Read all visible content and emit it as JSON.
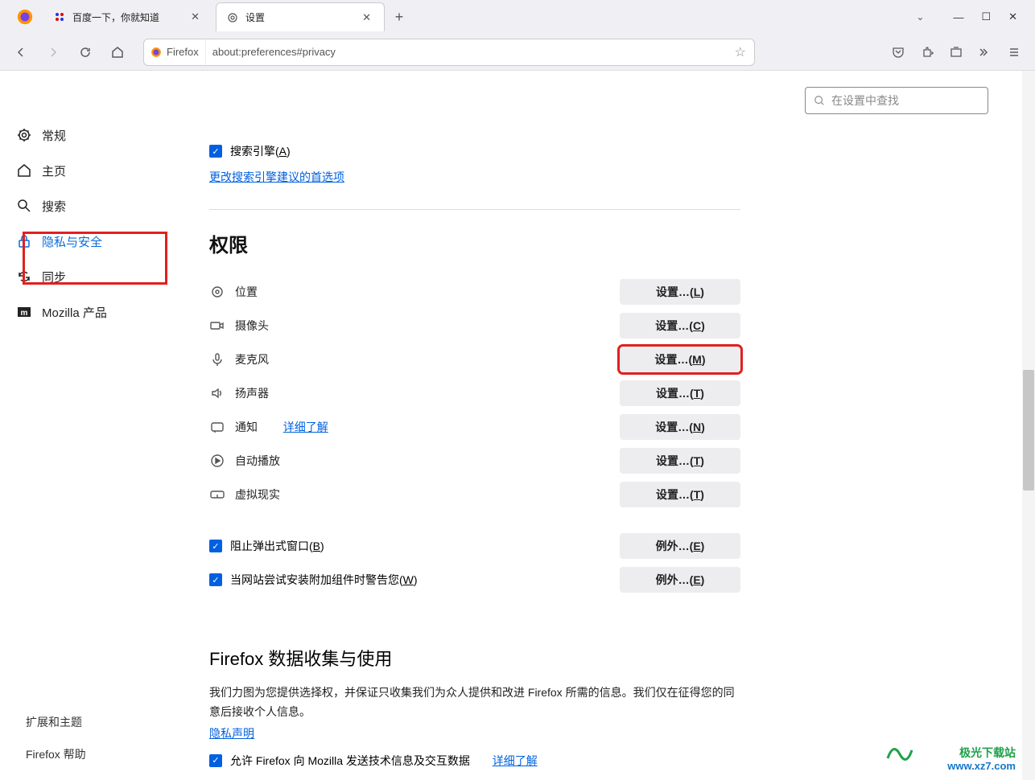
{
  "tabs": {
    "baidu": {
      "title": "百度一下，你就知道"
    },
    "settings": {
      "title": "设置"
    }
  },
  "urlbar": {
    "identity": "Firefox",
    "address": "about:preferences#privacy"
  },
  "search": {
    "placeholder": "在设置中查找"
  },
  "sidebar": {
    "general": "常规",
    "home": "主页",
    "search": "搜索",
    "privacy": "隐私与安全",
    "sync": "同步",
    "mozilla": "Mozilla 产品",
    "extensions": "扩展和主题",
    "help": "Firefox 帮助"
  },
  "checkboxes": {
    "search_engine": "搜索引擎(A)",
    "search_link": "更改搜索引擎建议的首选项",
    "block_popup": "阻止弹出式窗口(B)",
    "warn_addon": "当网站尝试安装附加组件时警告您(W)",
    "telemetry": "允许 Firefox 向 Mozilla 发送技术信息及交互数据"
  },
  "sections": {
    "permissions": "权限",
    "data_collection": "Firefox 数据收集与使用"
  },
  "permissions": {
    "location": {
      "label": "位置",
      "btn_prefix": "设置…(",
      "btn_key": "L",
      "btn_suffix": ")"
    },
    "camera": {
      "label": "摄像头",
      "btn_prefix": "设置…(",
      "btn_key": "C",
      "btn_suffix": ")"
    },
    "microphone": {
      "label": "麦克风",
      "btn_prefix": "设置…(",
      "btn_key": "M",
      "btn_suffix": ")"
    },
    "speaker": {
      "label": "扬声器",
      "btn_prefix": "设置…(",
      "btn_key": "T",
      "btn_suffix": ")"
    },
    "notification": {
      "label": "通知",
      "link": "详细了解",
      "btn_prefix": "设置…(",
      "btn_key": "N",
      "btn_suffix": ")"
    },
    "autoplay": {
      "label": "自动播放",
      "btn_prefix": "设置…(",
      "btn_key": "T",
      "btn_suffix": ")"
    },
    "vr": {
      "label": "虚拟现实",
      "btn_prefix": "设置…(",
      "btn_key": "T",
      "btn_suffix": ")"
    },
    "popup_btn": {
      "btn_prefix": "例外…(",
      "btn_key": "E",
      "btn_suffix": ")"
    },
    "addon_btn": {
      "btn_prefix": "例外…(",
      "btn_key": "E",
      "btn_suffix": ")"
    }
  },
  "data_text": {
    "line": "我们力图为您提供选择权，并保证只收集我们为众人提供和改进 Firefox 所需的信息。我们仅在征得您的同意后接收个人信息。",
    "privacy_link": "隐私声明",
    "learn_more": "详细了解"
  },
  "watermark": {
    "l1": "极光下载站",
    "l2": "www.xz7.com"
  }
}
